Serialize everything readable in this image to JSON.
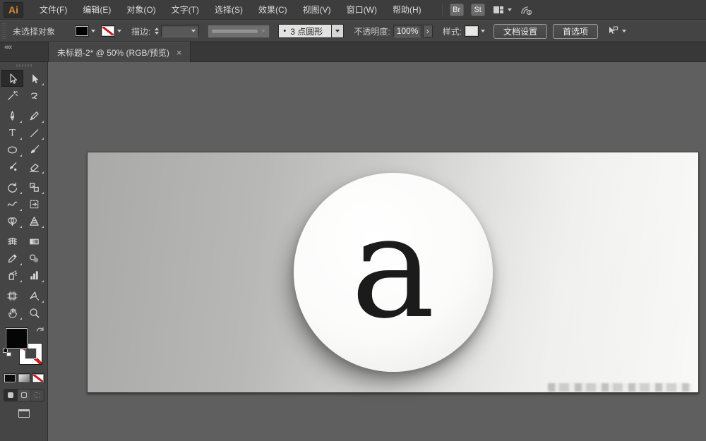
{
  "window": {
    "logo_text": "Ai"
  },
  "menubar": {
    "items": [
      {
        "id": "file",
        "label": "文件(F)"
      },
      {
        "id": "edit",
        "label": "编辑(E)"
      },
      {
        "id": "object",
        "label": "对象(O)"
      },
      {
        "id": "type",
        "label": "文字(T)"
      },
      {
        "id": "select",
        "label": "选择(S)"
      },
      {
        "id": "effect",
        "label": "效果(C)"
      },
      {
        "id": "view",
        "label": "视图(V)"
      },
      {
        "id": "window",
        "label": "窗口(W)"
      },
      {
        "id": "help",
        "label": "帮助(H)"
      }
    ],
    "bridge_badge": "Br",
    "stock_badge": "St"
  },
  "controlbar": {
    "selection_status": "未选择对象",
    "stroke_label": "描边:",
    "brush_bullet": "•",
    "brush_name": "3 点圆形",
    "opacity_label": "不透明度:",
    "opacity_value": "100%",
    "opacity_more": "›",
    "style_label": "样式:",
    "document_setup": "文档设置",
    "preferences": "首选项"
  },
  "tabbar": {
    "collapse_glyph": "««",
    "title": "未标题-2* @ 50% (RGB/预览)",
    "close_glyph": "×"
  },
  "toolbar": {
    "selected_tool": "selection-tool",
    "tools": [
      {
        "name": "selection-tool",
        "selected": true,
        "flyout": false
      },
      {
        "name": "direct-selection-tool",
        "flyout": true
      },
      {
        "name": "magic-wand-tool",
        "flyout": false
      },
      {
        "name": "lasso-tool",
        "flyout": false
      },
      {
        "name": "pen-tool",
        "flyout": true
      },
      {
        "name": "pencil-tool",
        "flyout": true
      },
      {
        "name": "type-tool",
        "flyout": true
      },
      {
        "name": "line-segment-tool",
        "flyout": true
      },
      {
        "name": "ellipse-tool",
        "flyout": true
      },
      {
        "name": "paintbrush-tool",
        "flyout": false
      },
      {
        "name": "blob-brush-tool",
        "flyout": false
      },
      {
        "name": "eraser-tool",
        "flyout": true
      },
      {
        "name": "rotate-tool",
        "flyout": true
      },
      {
        "name": "scale-tool",
        "flyout": true
      },
      {
        "name": "width-tool",
        "flyout": true
      },
      {
        "name": "free-transform-tool",
        "flyout": false
      },
      {
        "name": "shape-builder-tool",
        "flyout": true
      },
      {
        "name": "perspective-grid-tool",
        "flyout": true
      },
      {
        "name": "mesh-tool",
        "flyout": false
      },
      {
        "name": "gradient-tool",
        "flyout": false
      },
      {
        "name": "eyedropper-tool",
        "flyout": true
      },
      {
        "name": "blend-tool",
        "flyout": false
      },
      {
        "name": "symbol-sprayer-tool",
        "flyout": true
      },
      {
        "name": "column-graph-tool",
        "flyout": true
      },
      {
        "name": "artboard-tool",
        "flyout": false
      },
      {
        "name": "slice-tool",
        "flyout": true
      },
      {
        "name": "hand-tool",
        "flyout": true
      },
      {
        "name": "zoom-tool",
        "flyout": false
      }
    ],
    "separator_after_rows": [
      2,
      6,
      9,
      12
    ]
  },
  "canvas": {
    "artboard": {
      "letter": "a"
    },
    "colors": {
      "pasteboard": "#5f5f5f",
      "artboard_gradient_start": "#a9a9a7",
      "artboard_gradient_end": "#f8f8f6",
      "disc_fill": "#ffffff",
      "letter_color": "#1b1b1b",
      "none_swatch_red": "#c81e1e",
      "logo_orange": "#d98a35"
    }
  }
}
